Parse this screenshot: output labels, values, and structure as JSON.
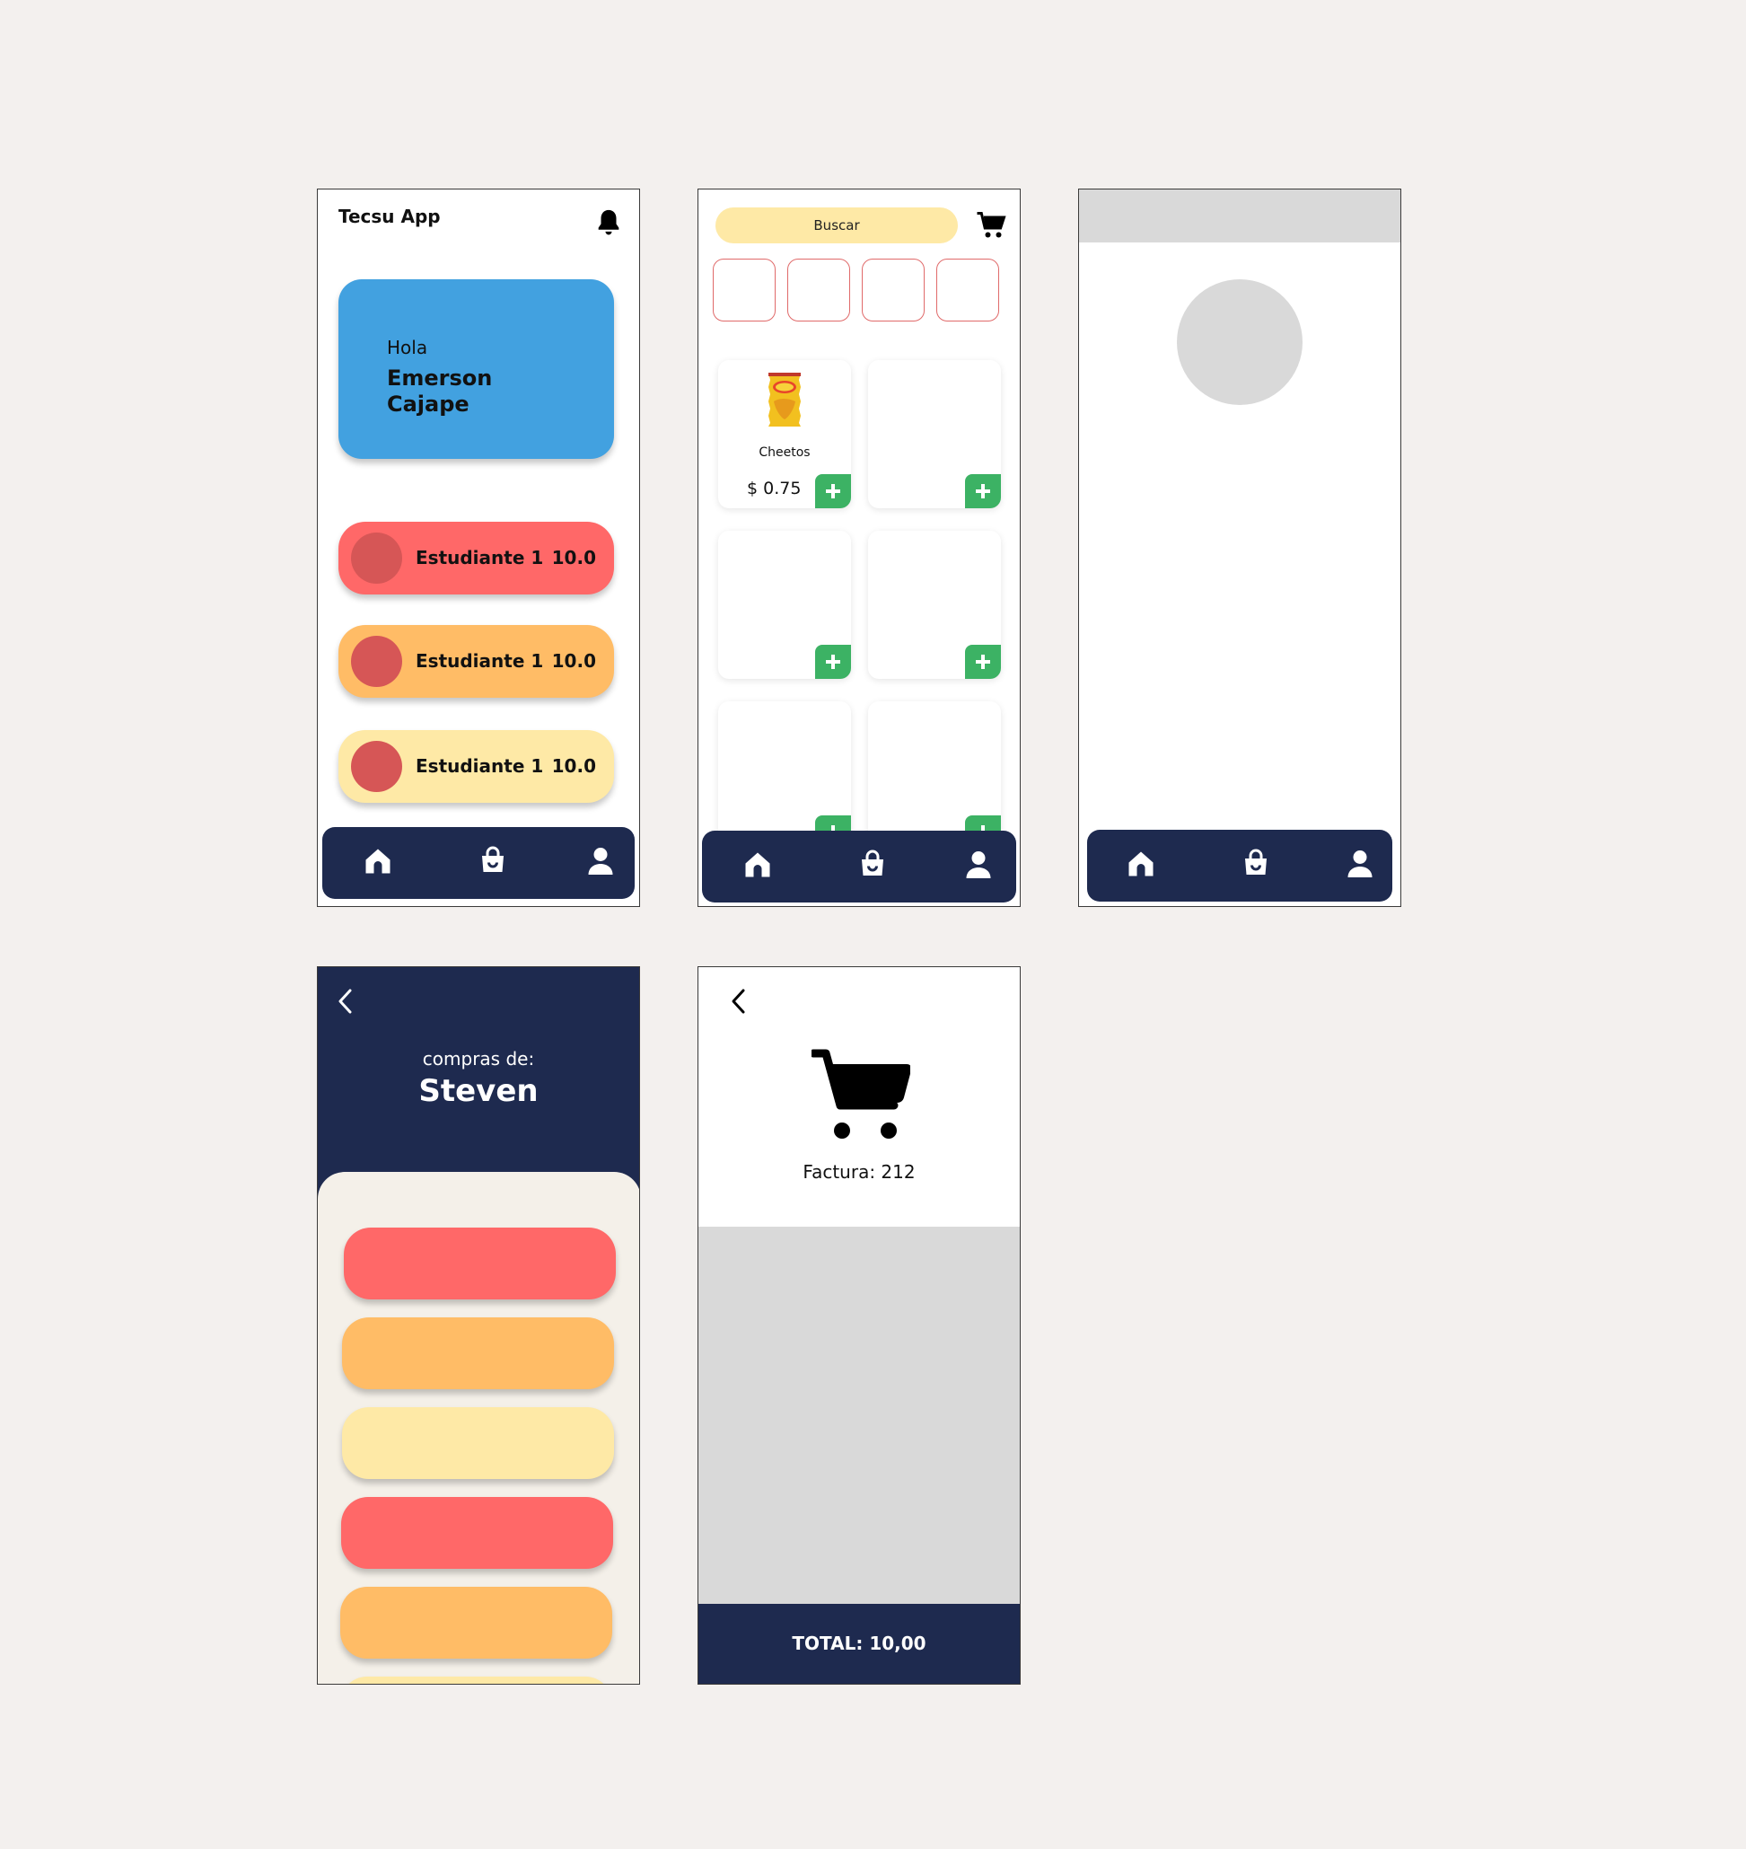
{
  "screen_home": {
    "app_title": "Tecsu App",
    "greeting": "Hola",
    "user_name": "Emerson Cajape",
    "students": [
      {
        "name": "Estudiante 1",
        "score": "10.0",
        "color": "#FF6868"
      },
      {
        "name": "Estudiante 1",
        "score": "10.0",
        "color": "#FFBC66"
      },
      {
        "name": "Estudiante 1",
        "score": "10.0",
        "color": "#FEE9A6"
      }
    ],
    "hero_color": "#42A1E0"
  },
  "screen_shop": {
    "search_placeholder": "Buscar",
    "product": {
      "name": "Cheetos",
      "price": "$ 0.75"
    },
    "add_button_color": "#3CB264"
  },
  "screen_purchases": {
    "label": "compras de:",
    "name": "Steven",
    "pill_colors": [
      "#FF6868",
      "#FFBC66",
      "#FEE9A6",
      "#FF6868",
      "#FFBC66",
      "#FEE9A6"
    ]
  },
  "screen_invoice": {
    "factura": "Factura: 212",
    "total": "TOTAL: 10,00"
  },
  "navbar": {
    "items": [
      "home-icon",
      "shopping-bag-icon",
      "user-icon"
    ],
    "color": "#1E2A4F"
  }
}
